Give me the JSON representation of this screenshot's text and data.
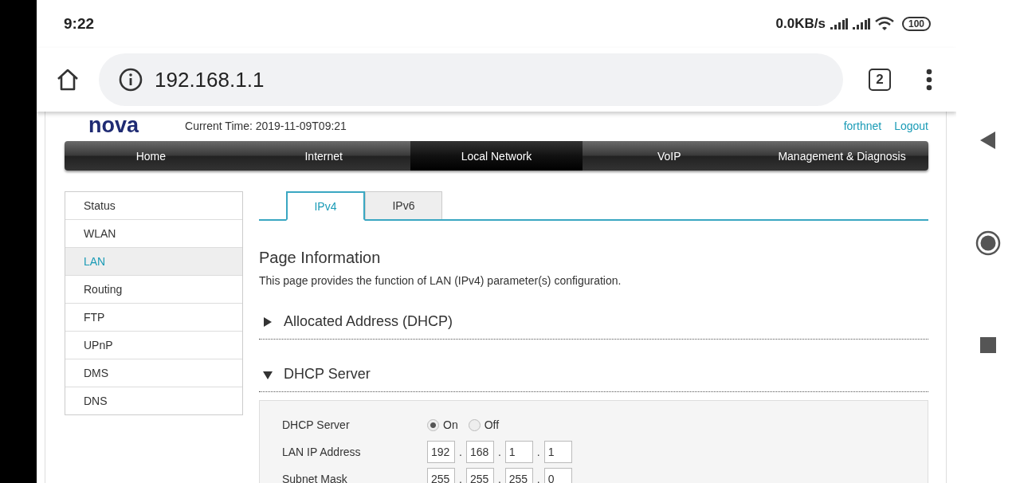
{
  "status_bar": {
    "time": "9:22",
    "net_speed": "0.0KB/s",
    "battery": "100"
  },
  "browser": {
    "url": "192.168.1.1",
    "tab_count": "2"
  },
  "header": {
    "logo": "nova",
    "current_time": "Current Time: 2019-11-09T09:21",
    "user": "forthnet",
    "logout": "Logout"
  },
  "nav": [
    {
      "label": "Home",
      "selected": false
    },
    {
      "label": "Internet",
      "selected": false
    },
    {
      "label": "Local Network",
      "selected": true
    },
    {
      "label": "VoIP",
      "selected": false
    },
    {
      "label": "Management & Diagnosis",
      "selected": false
    }
  ],
  "sidebar": [
    {
      "label": "Status",
      "selected": false
    },
    {
      "label": "WLAN",
      "selected": false
    },
    {
      "label": "LAN",
      "selected": true
    },
    {
      "label": "Routing",
      "selected": false
    },
    {
      "label": "FTP",
      "selected": false
    },
    {
      "label": "UPnP",
      "selected": false
    },
    {
      "label": "DMS",
      "selected": false
    },
    {
      "label": "DNS",
      "selected": false
    }
  ],
  "tabs": [
    {
      "label": "IPv4",
      "selected": true
    },
    {
      "label": "IPv6",
      "selected": false
    }
  ],
  "page_info": {
    "title": "Page Information",
    "description": "This page provides the function of LAN (IPv4) parameter(s) configuration."
  },
  "sections": [
    {
      "title": "Allocated Address (DHCP)",
      "expanded": false
    },
    {
      "title": "DHCP Server",
      "expanded": true,
      "fields": [
        {
          "kind": "radio",
          "label": "DHCP Server",
          "options": [
            {
              "label": "On",
              "selected": true
            },
            {
              "label": "Off",
              "selected": false
            }
          ]
        },
        {
          "kind": "ip",
          "label": "LAN IP Address",
          "separator": ".",
          "octets": [
            "192",
            "168",
            "1",
            "1"
          ]
        },
        {
          "kind": "ip",
          "label": "Subnet Mask",
          "separator": ".",
          "octets": [
            "255",
            "255",
            "255",
            "0"
          ]
        }
      ]
    }
  ]
}
